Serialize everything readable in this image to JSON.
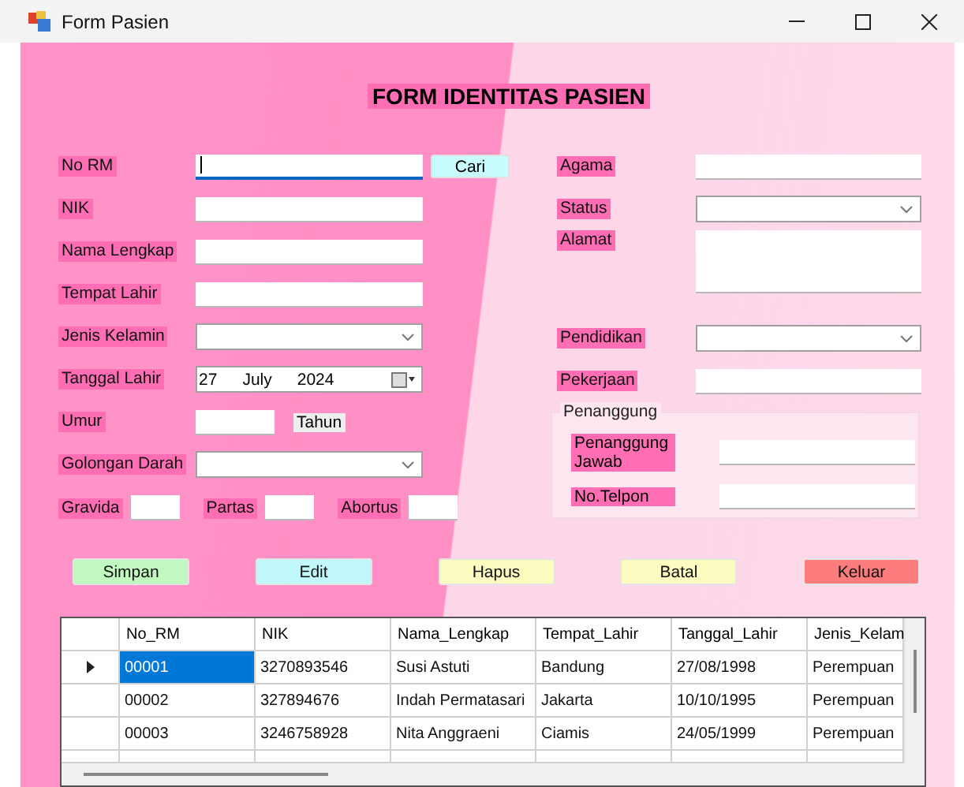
{
  "window": {
    "title": "Form Pasien"
  },
  "heading": "FORM IDENTITAS PASIEN",
  "left_fields": [
    {
      "label": "No RM",
      "kind": "text",
      "focused": true,
      "button": "Cari"
    },
    {
      "label": "NIK",
      "kind": "text",
      "focused": false
    },
    {
      "label": "Nama Lengkap",
      "kind": "text",
      "focused": false
    },
    {
      "label": "Tempat Lahir",
      "kind": "text",
      "focused": false
    },
    {
      "label": "Jenis Kelamin",
      "kind": "combo"
    },
    {
      "label": "Tanggal Lahir",
      "kind": "date",
      "date": [
        "27",
        "July",
        "2024"
      ]
    },
    {
      "label": "Umur",
      "kind": "short",
      "focused": false,
      "unit": "Tahun"
    },
    {
      "label": "Golongan Darah",
      "kind": "combo"
    }
  ],
  "obstetric": [
    {
      "label": "Gravida"
    },
    {
      "label": "Partas"
    },
    {
      "label": "Abortus"
    }
  ],
  "right_fields": [
    {
      "label": "Agama",
      "kind": "text"
    },
    {
      "label": "Status",
      "kind": "combo"
    },
    {
      "label": "Alamat",
      "kind": "textarea"
    },
    {
      "label": "Pendidikan",
      "kind": "combo"
    },
    {
      "label": "Pekerjaan",
      "kind": "text"
    }
  ],
  "guarantor": {
    "title": "Penanggung",
    "fields": [
      {
        "label": "Penanggung Jawab"
      },
      {
        "label": "No.Telpon"
      }
    ]
  },
  "buttons": [
    {
      "label": "Simpan",
      "color": "#c0f8c0"
    },
    {
      "label": "Edit",
      "color": "#c0f8fc"
    },
    {
      "label": "Hapus",
      "color": "#fcfcc0"
    },
    {
      "label": "Batal",
      "color": "#fcfcc0"
    },
    {
      "label": "Keluar",
      "color": "#fc7c7c"
    }
  ],
  "table": {
    "columns": [
      "No_RM",
      "NIK",
      "Nama_Lengkap",
      "Tempat_Lahir",
      "Tanggal_Lahir",
      "Jenis_Kelam"
    ],
    "rows": [
      {
        "selected": true,
        "cells": [
          "00001",
          "3270893546",
          "Susi Astuti",
          "Bandung",
          "27/08/1998",
          "Perempuan"
        ]
      },
      {
        "selected": false,
        "cells": [
          "00002",
          "327894676",
          "Indah Permatasari",
          "Jakarta",
          "10/10/1995",
          "Perempuan"
        ]
      },
      {
        "selected": false,
        "cells": [
          "00003",
          "3246758928",
          "Nita Anggraeni",
          "Ciamis",
          "24/05/1999",
          "Perempuan"
        ]
      }
    ]
  }
}
